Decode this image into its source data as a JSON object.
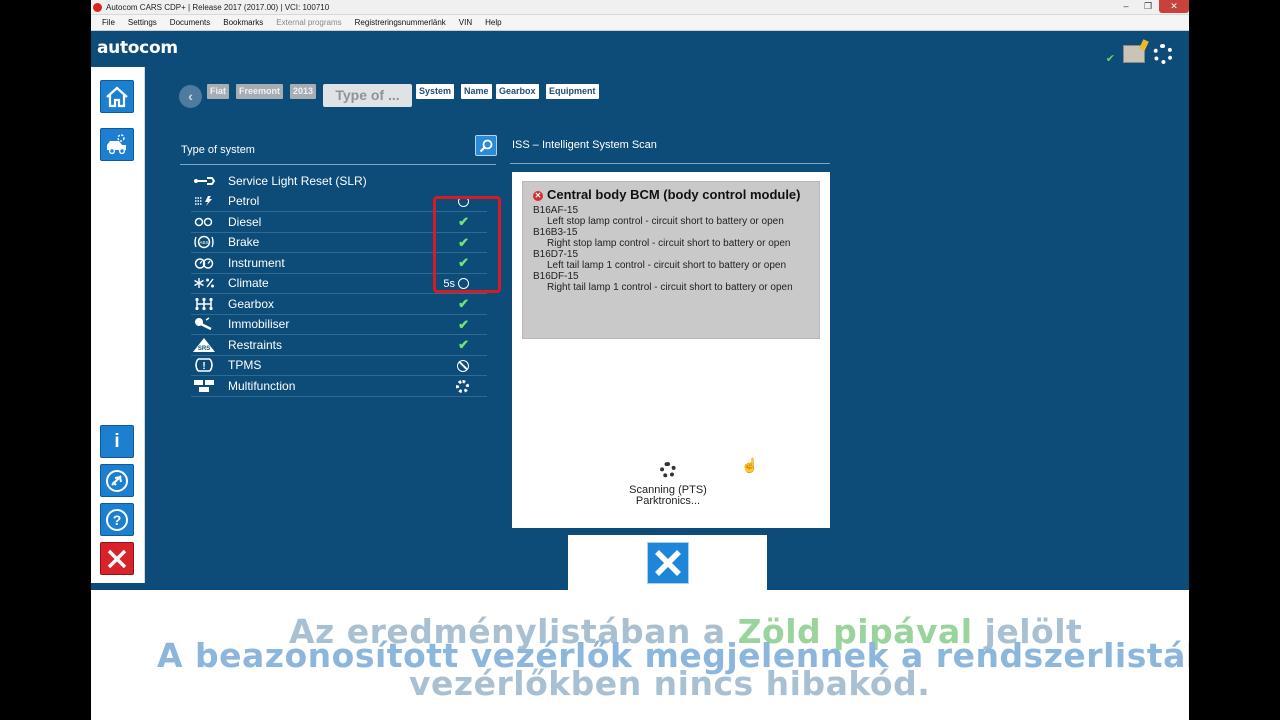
{
  "window": {
    "title": "Autocom CARS CDP+ | Release 2017 (2017.00) | VCI: 100710"
  },
  "menu": [
    {
      "label": "File",
      "enabled": true
    },
    {
      "label": "Settings",
      "enabled": true
    },
    {
      "label": "Documents",
      "enabled": true
    },
    {
      "label": "Bookmarks",
      "enabled": true
    },
    {
      "label": "External programs",
      "enabled": false
    },
    {
      "label": "Registreringsnummerlänk",
      "enabled": true
    },
    {
      "label": "VIN",
      "enabled": true
    },
    {
      "label": "Help",
      "enabled": true
    }
  ],
  "header": {
    "logo": "autocom",
    "icons": [
      "check-icon",
      "vci-icon",
      "settings-gear-icon"
    ]
  },
  "sidebar": {
    "top_buttons": [
      "home-icon",
      "vehicle-car-icon"
    ],
    "bottom_buttons": [
      "info-icon",
      "plane-icon",
      "help-icon",
      "exit-icon"
    ]
  },
  "breadcrumb": {
    "items": [
      {
        "label": "Fiat",
        "style": "gray"
      },
      {
        "label": "Freemont",
        "style": "gray"
      },
      {
        "label": "2013",
        "style": "gray"
      },
      {
        "label": "Type of ...",
        "style": "placeholder"
      },
      {
        "label": "System",
        "style": "white"
      },
      {
        "label": "Name",
        "style": "white"
      },
      {
        "label": "Gearbox",
        "style": "white"
      },
      {
        "label": "Equipment",
        "style": "white"
      }
    ]
  },
  "systems": {
    "title": "Type of system",
    "items": [
      {
        "label": "Service Light Reset (SLR)",
        "icon": "wrench-icon",
        "status": "none",
        "status_text": ""
      },
      {
        "label": "Petrol",
        "icon": "petrol-injection-icon",
        "status": "timer",
        "status_text": ""
      },
      {
        "label": "Diesel",
        "icon": "diesel-glow-plug-icon",
        "status": "ok",
        "status_text": ""
      },
      {
        "label": "Brake",
        "icon": "brake-abs-icon",
        "status": "ok",
        "status_text": ""
      },
      {
        "label": "Instrument",
        "icon": "instrument-cluster-icon",
        "status": "ok",
        "status_text": ""
      },
      {
        "label": "Climate",
        "icon": "climate-icon",
        "status": "timer",
        "status_text": "5s"
      },
      {
        "label": "Gearbox",
        "icon": "gearbox-icon",
        "status": "ok",
        "status_text": ""
      },
      {
        "label": "Immobiliser",
        "icon": "key-icon",
        "status": "ok",
        "status_text": ""
      },
      {
        "label": "Restraints",
        "icon": "srs-airbag-icon",
        "status": "ok",
        "status_text": ""
      },
      {
        "label": "TPMS",
        "icon": "tpms-icon",
        "status": "na",
        "status_text": ""
      },
      {
        "label": "Multifunction",
        "icon": "multifunction-icon",
        "status": "scanning",
        "status_text": ""
      }
    ]
  },
  "iss": {
    "title": "ISS – Intelligent System Scan",
    "card": {
      "title": "Central body BCM (body control module)",
      "dtcs": [
        {
          "code": "B16AF-15",
          "desc": "Left stop lamp control - circuit short to battery or open"
        },
        {
          "code": "B16B3-15",
          "desc": "Right stop lamp control - circuit short to battery or open"
        },
        {
          "code": "B16D7-15",
          "desc": "Left tail lamp 1 control - circuit short to battery or open"
        },
        {
          "code": "B16DF-15",
          "desc": "Right tail lamp 1 control - circuit short to battery or open"
        }
      ]
    },
    "scan_status_line1": "Scanning (PTS)",
    "scan_status_line2": "Parktronics..."
  },
  "subtitles": {
    "line1_pre": "Az eredménylistában a ",
    "line1_hl": "Zöld pipával",
    "line1_post": " jelölt",
    "line2": "A beazonosított vezérlők megjelennek a rendszerlistába",
    "line3": "vezérlőkben nincs hibakód."
  },
  "colors": {
    "background": "#0d4c78",
    "ok": "#73e07e",
    "highlight_box": "#d61b25",
    "button_blue": "#1e86d8",
    "exit_red": "#d8232a"
  }
}
